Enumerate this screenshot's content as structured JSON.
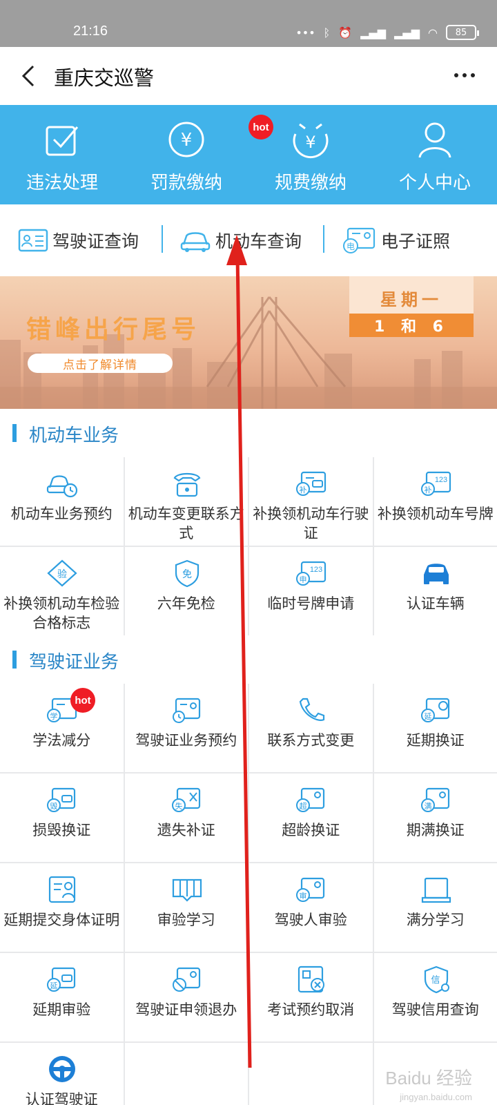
{
  "status_bar": {
    "time": "21:16",
    "battery": "85"
  },
  "header": {
    "title": "重庆交巡警"
  },
  "top_actions": [
    {
      "label": "违法处理",
      "icon": "checkbox-icon"
    },
    {
      "label": "罚款缴纳",
      "icon": "yuan-coin-icon"
    },
    {
      "label": "规费缴纳",
      "icon": "yuan-hourglass-icon",
      "badge": "hot"
    },
    {
      "label": "个人中心",
      "icon": "person-icon"
    }
  ],
  "query_bar": [
    {
      "label": "驾驶证查询",
      "icon": "id-card-icon"
    },
    {
      "label": "机动车查询",
      "icon": "car-outline-icon"
    },
    {
      "label": "电子证照",
      "icon": "e-license-icon"
    }
  ],
  "banner": {
    "title": "错峰出行尾号",
    "link": "点击了解详情",
    "day": "星期一",
    "numbers": "1 和 6"
  },
  "sections": {
    "vehicle": {
      "title": "机动车业务",
      "items": [
        {
          "label": "机动车业务预约",
          "icon": "car-clock-icon"
        },
        {
          "label": "机动车变更联系方式",
          "icon": "phone-icon"
        },
        {
          "label": "补换领机动车行驶证",
          "icon": "license-replace-icon"
        },
        {
          "label": "补换领机动车号牌",
          "icon": "plate-replace-icon"
        },
        {
          "label": "补换领机动车检验合格标志",
          "icon": "inspection-badge-icon"
        },
        {
          "label": "六年免检",
          "icon": "exempt-shield-icon"
        },
        {
          "label": "临时号牌申请",
          "icon": "temp-plate-icon"
        },
        {
          "label": "认证车辆",
          "icon": "car-filled-icon"
        }
      ]
    },
    "license": {
      "title": "驾驶证业务",
      "items": [
        {
          "label": "学法减分",
          "icon": "study-car-icon",
          "badge": "hot"
        },
        {
          "label": "驾驶证业务预约",
          "icon": "license-clock-icon"
        },
        {
          "label": "联系方式变更",
          "icon": "phone-handset-icon"
        },
        {
          "label": "延期换证",
          "icon": "license-delay-icon"
        },
        {
          "label": "损毁换证",
          "icon": "license-damaged-icon"
        },
        {
          "label": "遗失补证",
          "icon": "license-lost-icon"
        },
        {
          "label": "超龄换证",
          "icon": "license-overage-icon"
        },
        {
          "label": "期满换证",
          "icon": "license-expire-icon"
        },
        {
          "label": "延期提交身体证明",
          "icon": "health-proof-icon"
        },
        {
          "label": "审验学习",
          "icon": "book-icon"
        },
        {
          "label": "驾驶人审验",
          "icon": "driver-review-icon"
        },
        {
          "label": "满分学习",
          "icon": "full-score-book-icon"
        },
        {
          "label": "延期审验",
          "icon": "review-delay-icon"
        },
        {
          "label": "驾驶证申领退办",
          "icon": "license-cancel-icon"
        },
        {
          "label": "考试预约取消",
          "icon": "exam-cancel-icon"
        },
        {
          "label": "驾驶信用查询",
          "icon": "credit-search-icon"
        },
        {
          "label": "认证驾驶证",
          "icon": "steering-wheel-icon"
        }
      ]
    }
  },
  "watermark": {
    "brand": "Baidu 经验",
    "url": "jingyan.baidu.com"
  },
  "colors": {
    "accent": "#41b3ea",
    "hot": "#ef1d25",
    "arrow": "#e0211c",
    "section_title": "#2a86c7"
  }
}
